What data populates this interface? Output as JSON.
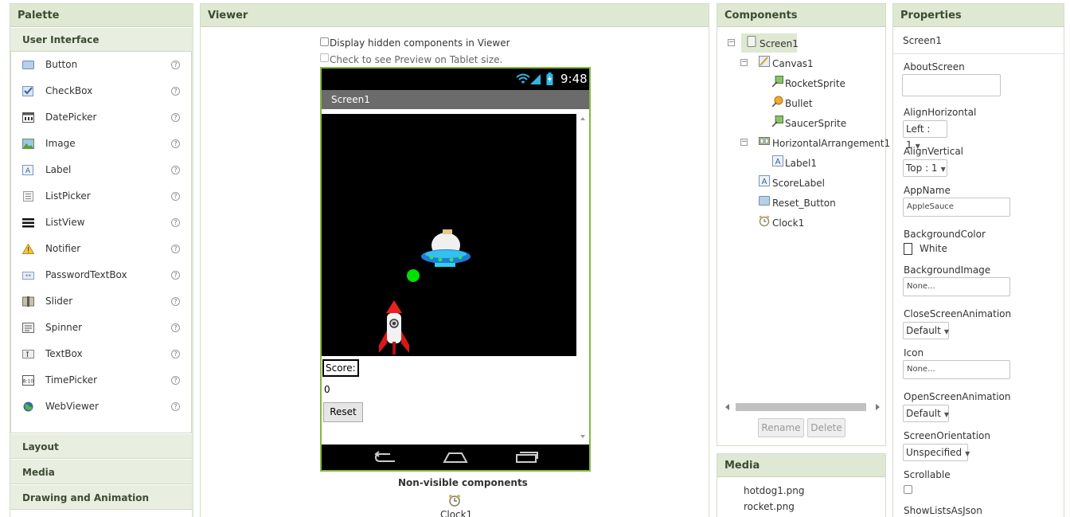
{
  "palette": {
    "title": "Palette",
    "open_category": "User Interface",
    "items": [
      {
        "label": "Button",
        "icon": "button-icon"
      },
      {
        "label": "CheckBox",
        "icon": "checkbox-icon"
      },
      {
        "label": "DatePicker",
        "icon": "datepicker-icon"
      },
      {
        "label": "Image",
        "icon": "image-icon"
      },
      {
        "label": "Label",
        "icon": "label-icon"
      },
      {
        "label": "ListPicker",
        "icon": "listpicker-icon"
      },
      {
        "label": "ListView",
        "icon": "listview-icon"
      },
      {
        "label": "Notifier",
        "icon": "notifier-icon"
      },
      {
        "label": "PasswordTextBox",
        "icon": "passwordtextbox-icon"
      },
      {
        "label": "Slider",
        "icon": "slider-icon"
      },
      {
        "label": "Spinner",
        "icon": "spinner-icon"
      },
      {
        "label": "TextBox",
        "icon": "textbox-icon"
      },
      {
        "label": "TimePicker",
        "icon": "timepicker-icon"
      },
      {
        "label": "WebViewer",
        "icon": "webviewer-icon"
      }
    ],
    "help_glyph": "?",
    "other_categories": [
      "Layout",
      "Media",
      "Drawing and Animation"
    ]
  },
  "viewer": {
    "title": "Viewer",
    "hidden_components_label": "Display hidden components in Viewer",
    "tablet_preview_label": "Check to see Preview on Tablet size.",
    "status_time": "9:48",
    "screen_title": "Screen1",
    "score_label": "Score:",
    "score_value": "0",
    "reset_label": "Reset",
    "nonvisible_title": "Non-visible components",
    "nonvisible_item": "Clock1"
  },
  "components": {
    "title": "Components",
    "tree": [
      {
        "label": "Screen1",
        "icon": "screen-icon",
        "selected": true
      },
      {
        "label": "Canvas1",
        "icon": "canvas-icon"
      },
      {
        "label": "RocketSprite",
        "icon": "imagesprite-icon"
      },
      {
        "label": "Bullet",
        "icon": "ball-icon"
      },
      {
        "label": "SaucerSprite",
        "icon": "imagesprite-icon"
      },
      {
        "label": "HorizontalArrangement1",
        "icon": "horizontalarrangement-icon"
      },
      {
        "label": "Label1",
        "icon": "label-icon"
      },
      {
        "label": "ScoreLabel",
        "icon": "label-icon"
      },
      {
        "label": "Reset_Button",
        "icon": "button-icon"
      },
      {
        "label": "Clock1",
        "icon": "clock-icon"
      }
    ],
    "rename_label": "Rename",
    "delete_label": "Delete"
  },
  "media": {
    "title": "Media",
    "files": [
      "hotdog1.png",
      "rocket.png"
    ]
  },
  "properties": {
    "title": "Properties",
    "component": "Screen1",
    "about_label": "AboutScreen",
    "align_h_label": "AlignHorizontal",
    "align_h_value": "Left : 1",
    "align_v_label": "AlignVertical",
    "align_v_value": "Top : 1",
    "app_name_label": "AppName",
    "app_name_value": "AppleSauce",
    "bg_color_label": "BackgroundColor",
    "bg_color_value": "White",
    "bg_image_label": "BackgroundImage",
    "bg_image_value": "None...",
    "close_anim_label": "CloseScreenAnimation",
    "close_anim_value": "Default",
    "icon_label": "Icon",
    "icon_value": "None...",
    "open_anim_label": "OpenScreenAnimation",
    "open_anim_value": "Default",
    "orientation_label": "ScreenOrientation",
    "orientation_value": "Unspecified",
    "scrollable_label": "Scrollable",
    "show_lists_label": "ShowListsAsJson"
  },
  "colors": {
    "panel_header": "#dfe8d2",
    "accent_green": "#85b83f",
    "canvas_bg": "#000000",
    "bullet": "#00e000"
  }
}
